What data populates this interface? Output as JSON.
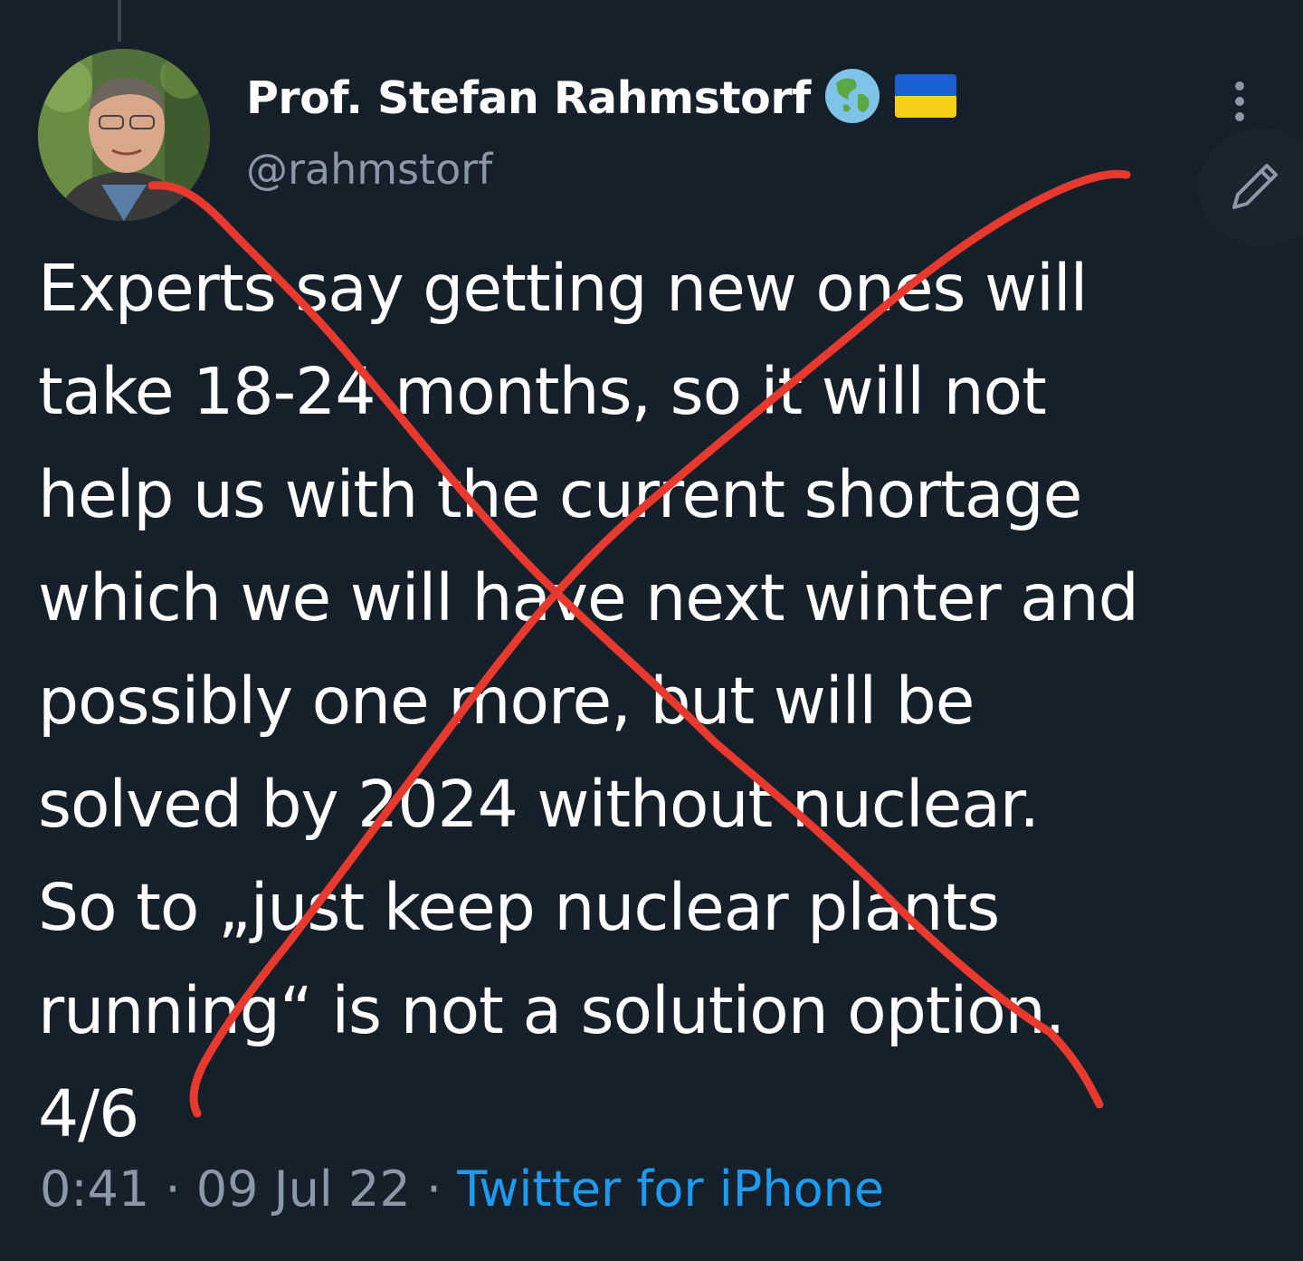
{
  "tweet": {
    "author": {
      "display_name": "Prof. Stefan Rahmstorf",
      "handle": "@rahmstorf",
      "name_emojis": [
        "globe-asia-australia-emoji",
        "ukraine-flag-emoji"
      ]
    },
    "text_lines": [
      "Experts say getting new ones will",
      "take 18-24 months, so it will not",
      "help us with the current shortage",
      "which we will have next winter and",
      "possibly one more, but will be",
      "solved by 2024 without nuclear.",
      "So to „just keep nuclear plants",
      "running“ is not a solution option.",
      "4/6"
    ],
    "meta": {
      "time": "0:41",
      "separator": "·",
      "date": "09 Jul 22",
      "source": "Twitter for iPhone"
    }
  },
  "icons": {
    "more": "more-vertical-icon",
    "compose": "pencil-icon"
  },
  "overlay": {
    "type": "red-cross-out",
    "color": "#e8392f"
  },
  "colors": {
    "background": "#15202b",
    "text_primary": "#ffffff",
    "text_secondary": "#8b98a5",
    "link": "#1d9bf0",
    "cross": "#e8392f"
  }
}
